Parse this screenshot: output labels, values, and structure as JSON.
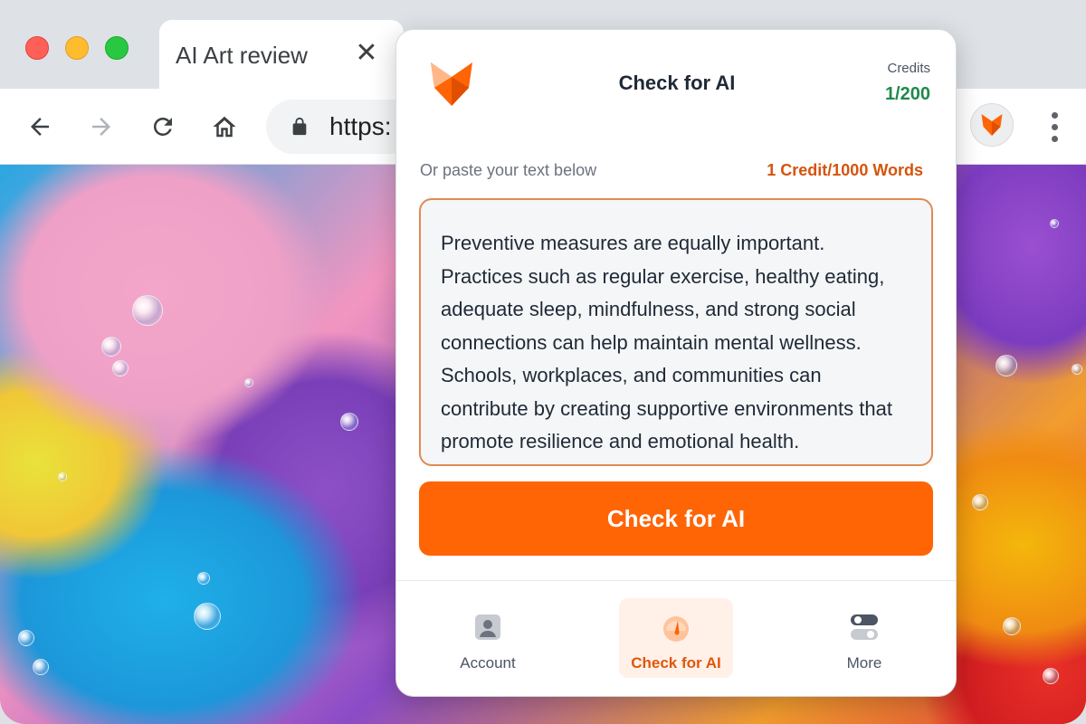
{
  "browser": {
    "tab_title": "AI Art review",
    "tab_close_glyph": "✕",
    "url_partial": "https:",
    "icons": [
      "back-arrow-icon",
      "forward-arrow-icon",
      "reload-icon",
      "home-icon",
      "lock-icon",
      "fox-extension-icon",
      "kebab-menu-icon"
    ]
  },
  "popup": {
    "title": "Check for AI",
    "credits": {
      "label": "Credits",
      "value": "1/200"
    },
    "paste_hint": "Or paste your text below",
    "rate": "1 Credit/1000 Words",
    "text": "Preventive measures are equally important. Practices such as regular exercise, healthy eating, adequate sleep, mindfulness, and strong social connections can help maintain mental wellness. Schools, workplaces, and communities can contribute by creating supportive environments that promote resilience and emotional health.",
    "button": "Check for AI",
    "nav": [
      {
        "label": "Account",
        "icon": "account-icon",
        "active": false
      },
      {
        "label": "Check for AI",
        "icon": "gauge-icon",
        "active": true
      },
      {
        "label": "More",
        "icon": "toggles-icon",
        "active": false
      }
    ]
  },
  "colors": {
    "accent": "#ff6405",
    "credits_green": "#1f8a4c",
    "rate_orange": "#d4540d"
  }
}
